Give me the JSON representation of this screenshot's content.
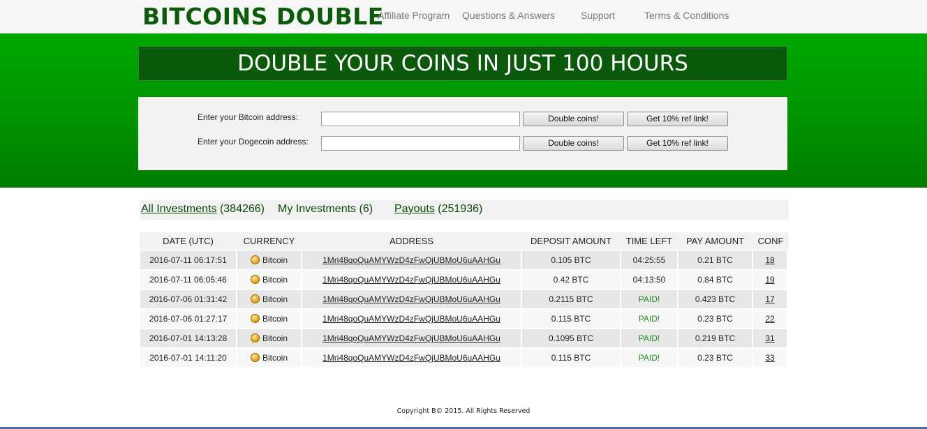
{
  "header": {
    "logo": "BITCOINS DOUBLE",
    "nav": [
      "Affiliate Program",
      "Questions & Answers",
      "Support",
      "Terms & Conditions"
    ]
  },
  "hero": {
    "banner": "DOUBLE YOUR COINS IN JUST 100 HOURS",
    "bitcoin_label": "Enter your Bitcoin address:",
    "bitcoin_value": "",
    "dogecoin_label": "Enter your Dogecoin address:",
    "dogecoin_value": "",
    "double_button": "Double coins!",
    "ref_button": "Get 10% ref link!"
  },
  "tabs": {
    "all_label": "All Investments",
    "all_count": "(384266)",
    "my_label": "My Investments",
    "my_count": "(6)",
    "payouts_label": "Payouts",
    "payouts_count": "(251936)"
  },
  "table": {
    "headers": [
      "DATE (UTC)",
      "CURRENCY",
      "ADDRESS",
      "DEPOSIT AMOUNT",
      "TIME LEFT",
      "PAY AMOUNT",
      "CONF"
    ],
    "rows": [
      {
        "date": "2016-07-11 06:17:51",
        "currency": "Bitcoin",
        "address": "1Mri48qoQuAMYWzD4zFwQjUBMoU6uAAHGu",
        "deposit": "0.105 BTC",
        "time_left": "04:25:55",
        "pay": "0.21 BTC",
        "conf": "18"
      },
      {
        "date": "2016-07-11 06:05:46",
        "currency": "Bitcoin",
        "address": "1Mri48qoQuAMYWzD4zFwQjUBMoU6uAAHGu",
        "deposit": "0.42 BTC",
        "time_left": "04:13:50",
        "pay": "0.84 BTC",
        "conf": "19"
      },
      {
        "date": "2016-07-06 01:31:42",
        "currency": "Bitcoin",
        "address": "1Mri48qoQuAMYWzD4zFwQjUBMoU6uAAHGu",
        "deposit": "0.2115 BTC",
        "time_left": "PAID!",
        "pay": "0.423 BTC",
        "conf": "17"
      },
      {
        "date": "2016-07-06 01:27:17",
        "currency": "Bitcoin",
        "address": "1Mri48qoQuAMYWzD4zFwQjUBMoU6uAAHGu",
        "deposit": "0.115 BTC",
        "time_left": "PAID!",
        "pay": "0.23 BTC",
        "conf": "22"
      },
      {
        "date": "2016-07-01 14:13:28",
        "currency": "Bitcoin",
        "address": "1Mri48qoQuAMYWzD4zFwQjUBMoU6uAAHGu",
        "deposit": "0.1095 BTC",
        "time_left": "PAID!",
        "pay": "0.219 BTC",
        "conf": "31"
      },
      {
        "date": "2016-07-01 14:11:20",
        "currency": "Bitcoin",
        "address": "1Mri48qoQuAMYWzD4zFwQjUBMoU6uAAHGu",
        "deposit": "0.115 BTC",
        "time_left": "PAID!",
        "pay": "0.23 BTC",
        "conf": "33"
      }
    ]
  },
  "footer": {
    "copyright": "Copyright B© 2015. All Rights Reserved"
  },
  "icons": {
    "currency_icon": "bitcoin-coin-icon"
  }
}
